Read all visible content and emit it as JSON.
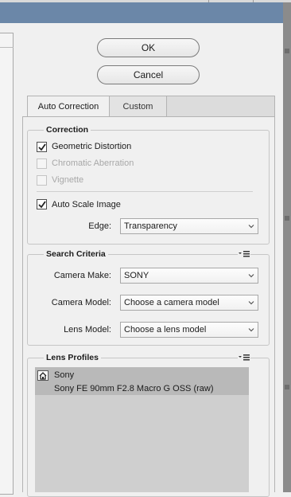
{
  "buttons": {
    "ok": "OK",
    "cancel": "Cancel"
  },
  "tabs": [
    {
      "label": "Auto Correction",
      "active": true
    },
    {
      "label": "Custom",
      "active": false
    }
  ],
  "correction": {
    "title": "Correction",
    "geometric_distortion": {
      "label": "Geometric Distortion",
      "checked": true,
      "enabled": true
    },
    "chromatic_aberration": {
      "label": "Chromatic Aberration",
      "checked": false,
      "enabled": false
    },
    "vignette": {
      "label": "Vignette",
      "checked": false,
      "enabled": false
    },
    "auto_scale": {
      "label": "Auto Scale Image",
      "checked": true,
      "enabled": true
    },
    "edge": {
      "label": "Edge:",
      "value": "Transparency"
    }
  },
  "search_criteria": {
    "title": "Search Criteria",
    "camera_make": {
      "label": "Camera Make:",
      "value": "SONY"
    },
    "camera_model": {
      "label": "Camera Model:",
      "value": "Choose a camera model"
    },
    "lens_model": {
      "label": "Lens Model:",
      "value": "Choose a lens model"
    }
  },
  "lens_profiles": {
    "title": "Lens Profiles",
    "items": [
      {
        "maker": "Sony",
        "lens": "Sony FE 90mm F2.8 Macro G OSS (raw)",
        "selected": true
      }
    ]
  },
  "icons": {
    "menu": "panel-menu-icon",
    "chevron": "chevron-down-icon",
    "check": "checkmark-icon",
    "home": "home-icon"
  },
  "colors": {
    "titlebar": "#6b87a8",
    "background": "#f0f0f0",
    "selected_item": "#b9b9b9"
  }
}
